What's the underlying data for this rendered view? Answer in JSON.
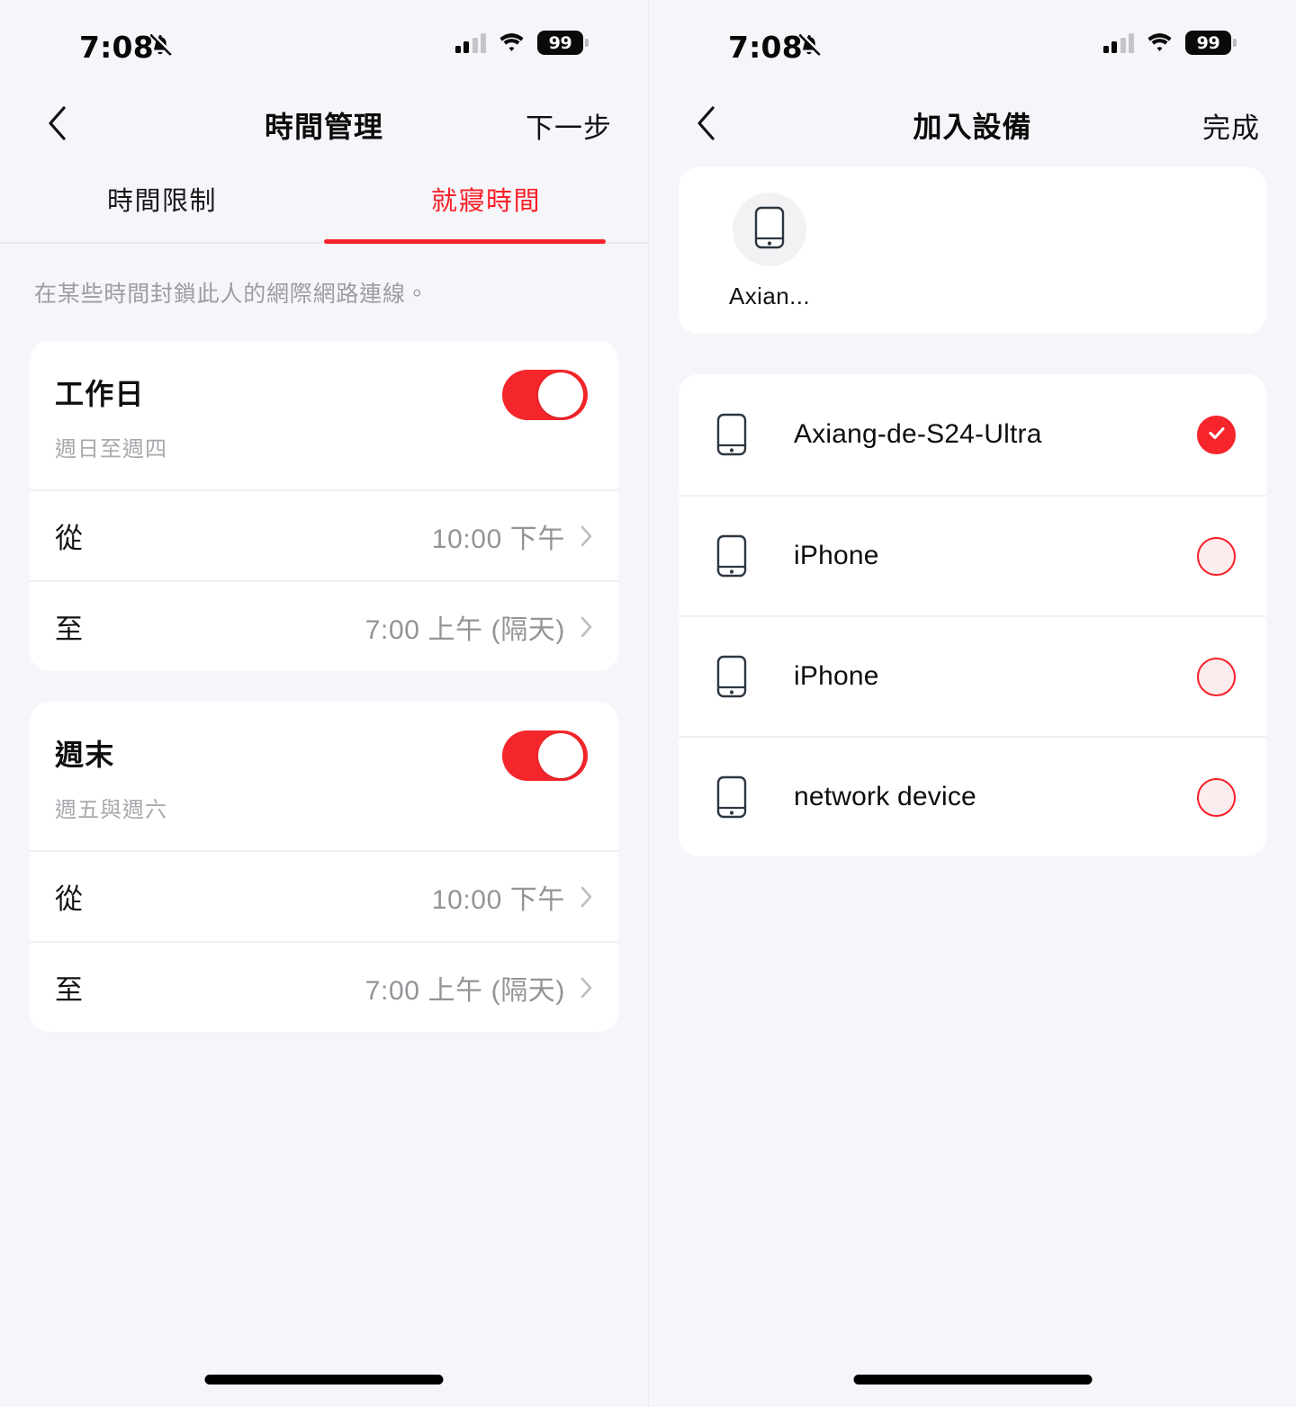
{
  "status_bar": {
    "time": "7:08",
    "bell_icon": "bell-muted-icon",
    "signal_icon": "cellular-signal-icon",
    "wifi_icon": "wifi-icon",
    "battery_level": "99"
  },
  "left_screen": {
    "nav": {
      "back_icon": "chevron-left-icon",
      "title": "時間管理",
      "action_label": "下一步"
    },
    "tabs": [
      {
        "label": "時間限制",
        "active": false
      },
      {
        "label": "就寢時間",
        "active": true
      }
    ],
    "description": "在某些時間封鎖此人的網際網路連線。",
    "schedules": [
      {
        "title": "工作日",
        "subtitle": "週日至週四",
        "enabled": true,
        "rows": [
          {
            "label": "從",
            "value": "10:00 下午"
          },
          {
            "label": "至",
            "value": "7:00 上午 (隔天)"
          }
        ]
      },
      {
        "title": "週末",
        "subtitle": "週五與週六",
        "enabled": true,
        "rows": [
          {
            "label": "從",
            "value": "10:00 下午"
          },
          {
            "label": "至",
            "value": "7:00 上午 (隔天)"
          }
        ]
      }
    ]
  },
  "right_screen": {
    "nav": {
      "back_icon": "chevron-left-icon",
      "title": "加入設備",
      "action_label": "完成"
    },
    "selected_chips": [
      {
        "name": "Axian...",
        "icon": "phone-icon"
      }
    ],
    "devices": [
      {
        "name": "Axiang-de-S24-Ultra",
        "icon": "phone-icon",
        "selected": true
      },
      {
        "name": "iPhone",
        "icon": "phone-icon",
        "selected": false
      },
      {
        "name": "iPhone",
        "icon": "phone-icon",
        "selected": false
      },
      {
        "name": "network device",
        "icon": "phone-icon",
        "selected": false
      }
    ]
  },
  "colors": {
    "accent_red": "#f5262b",
    "panel_background": "#f5f6fa",
    "card_background": "#ffffff",
    "muted_text": "#9c9da3"
  }
}
